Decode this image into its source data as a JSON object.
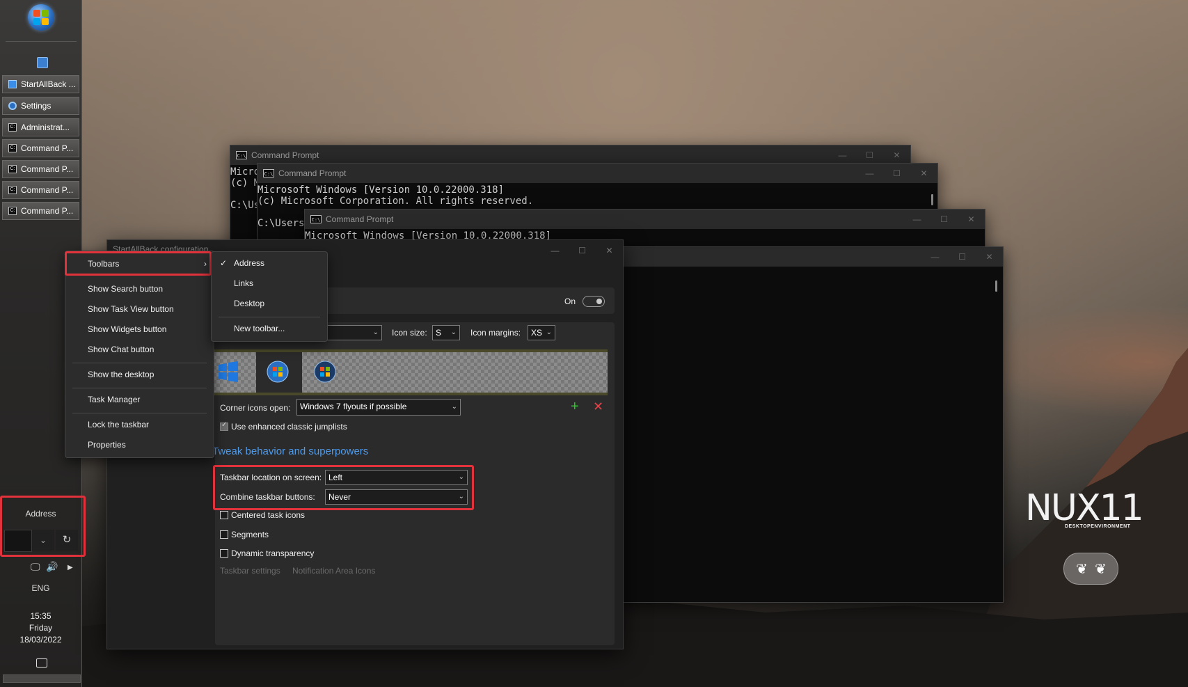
{
  "taskbar": {
    "buttons": [
      {
        "label": "StartAllBack ...",
        "icon": "book-icon"
      },
      {
        "label": "Settings",
        "icon": "gear-icon"
      },
      {
        "label": "Administrat...",
        "icon": "cmd-icon"
      },
      {
        "label": "Command P...",
        "icon": "cmd-icon"
      },
      {
        "label": "Command P...",
        "icon": "cmd-icon"
      },
      {
        "label": "Command P...",
        "icon": "cmd-icon"
      },
      {
        "label": "Command P...",
        "icon": "cmd-icon"
      }
    ],
    "address_toolbar": {
      "label": "Address",
      "value": ""
    },
    "language": "ENG",
    "clock": {
      "time": "15:35",
      "day": "Friday",
      "date": "18/03/2022"
    }
  },
  "cmd_windows": [
    {
      "title": "Command Prompt",
      "lines": [
        "Micro",
        "(c) M",
        "",
        "C:\\Us"
      ]
    },
    {
      "title": "Command Prompt",
      "lines": [
        "Microsoft Windows [Version 10.0.22000.318]",
        "(c) Microsoft Corporation. All rights reserved.",
        "",
        "C:\\Users"
      ]
    },
    {
      "title": "Command Prompt",
      "lines": [
        "Microsoft Windows [Version 10.0.22000.318]"
      ]
    },
    {
      "title": "",
      "lines": []
    }
  ],
  "config": {
    "title": "StartAllBack configuration",
    "toggle_label": "On",
    "icon_size_label": "Icon size:",
    "icon_size_value": "S",
    "icon_margins_label": "Icon margins:",
    "icon_margins_value": "XS",
    "corner_icons_label": "Corner icons open:",
    "corner_icons_value": "Windows 7 flyouts if possible",
    "enhanced_jumplists": "Use enhanced classic jumplists",
    "section_title": "Tweak behavior and superpowers",
    "taskbar_location_label": "Taskbar location on screen:",
    "taskbar_location_value": "Left",
    "combine_label": "Combine taskbar buttons:",
    "combine_value": "Never",
    "centered": "Centered task icons",
    "segments": "Segments",
    "dynamic_transparency": "Dynamic transparency",
    "taskbar_settings_link": "Taskbar settings",
    "notification_link": "Notification Area Icons"
  },
  "context_menu": {
    "items": [
      "Toolbars",
      "Show Search button",
      "Show Task View button",
      "Show Widgets button",
      "Show Chat button",
      "Show the desktop",
      "Task Manager",
      "Lock the taskbar",
      "Properties"
    ]
  },
  "toolbars_submenu": {
    "items": [
      "Address",
      "Links",
      "Desktop",
      "New toolbar..."
    ],
    "checked": "Address"
  },
  "brand": {
    "name": "NUX11",
    "tagline": "DESKTOPENVIRONMENT"
  }
}
